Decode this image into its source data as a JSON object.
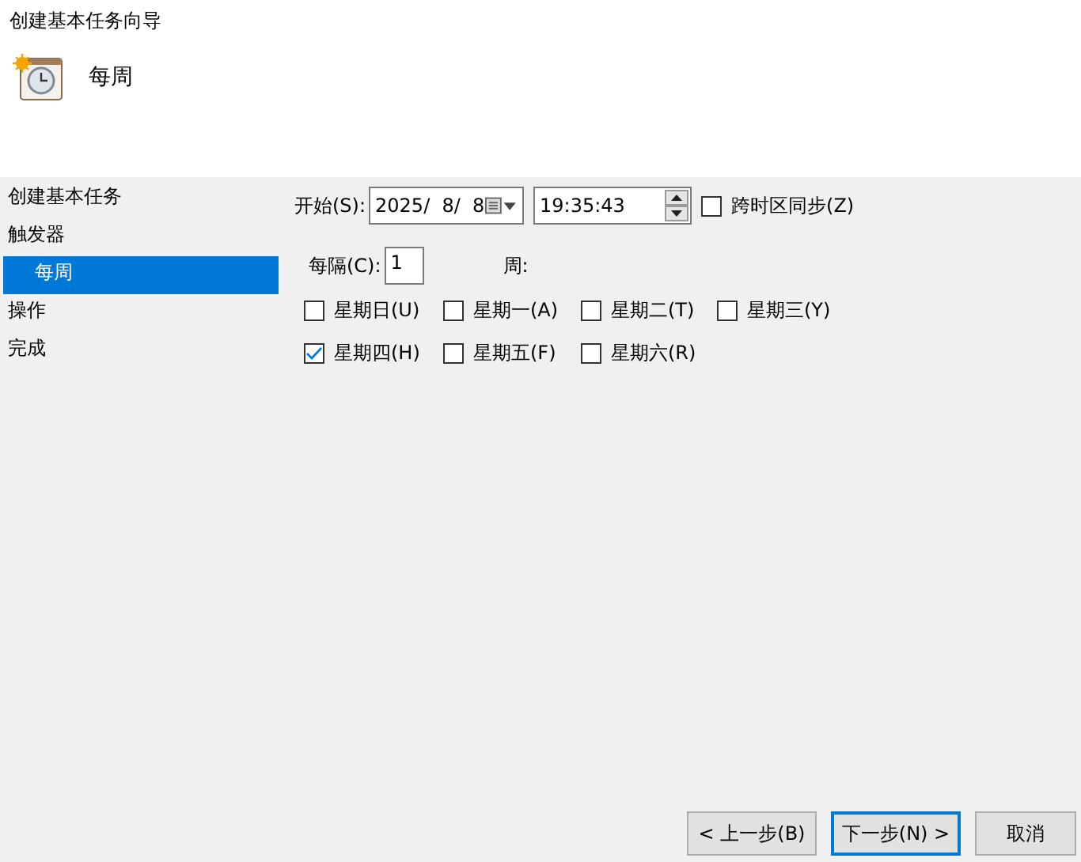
{
  "window": {
    "title": "创建基本任务向导"
  },
  "header": {
    "title": "每周"
  },
  "sidebar": {
    "items": [
      {
        "label": "创建基本任务",
        "selected": false
      },
      {
        "label": "触发器",
        "selected": false,
        "children": [
          {
            "label": "每周",
            "selected": true
          }
        ]
      },
      {
        "label": "操作",
        "selected": false
      },
      {
        "label": "完成",
        "selected": false
      }
    ]
  },
  "start": {
    "label": "开始(S):",
    "date": "2025/  8/  8",
    "time": "19:35:43",
    "sync": {
      "label": "跨时区同步(Z)",
      "checked": false
    }
  },
  "recur": {
    "label": "每隔(C):",
    "value": "1",
    "unit": "周:"
  },
  "days": [
    {
      "label": "星期日(U)",
      "checked": false
    },
    {
      "label": "星期一(A)",
      "checked": false
    },
    {
      "label": "星期二(T)",
      "checked": false
    },
    {
      "label": "星期三(Y)",
      "checked": false
    },
    {
      "label": "星期四(H)",
      "checked": true
    },
    {
      "label": "星期五(F)",
      "checked": false
    },
    {
      "label": "星期六(R)",
      "checked": false
    }
  ],
  "buttons": [
    {
      "label": "< 上一步(B)",
      "selected": false
    },
    {
      "label": "下一步(N) >",
      "selected": true
    },
    {
      "label": "取消",
      "selected": false
    }
  ]
}
